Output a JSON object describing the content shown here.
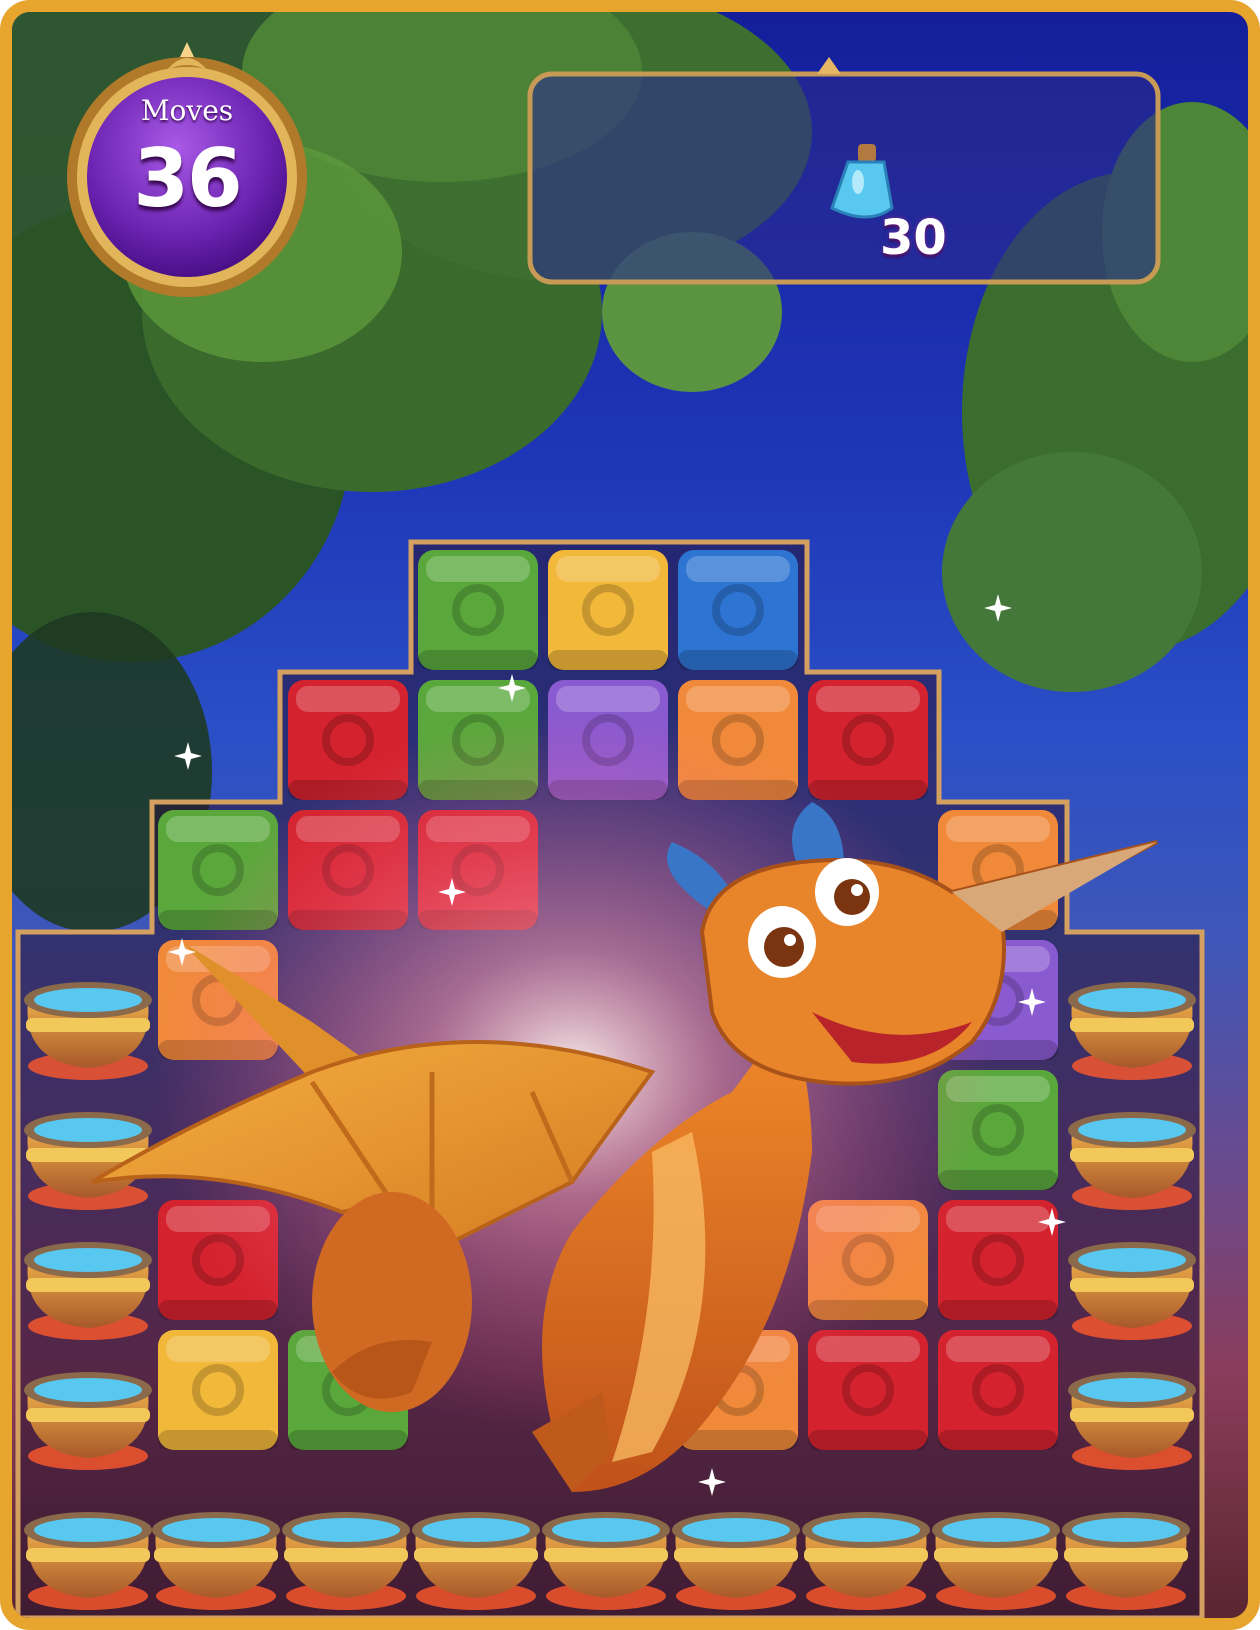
{
  "hud": {
    "moves_label": "Moves",
    "moves_value": "36",
    "goal": {
      "icon": "potion-bottle-icon",
      "count": "30"
    }
  },
  "colors": {
    "frame_gold": "#e7a52e",
    "moves_orb": "#7a2bbf",
    "block_green": "#5aa83c",
    "block_yellow": "#f1b83a",
    "block_blue": "#2e74d2",
    "block_red": "#d4232e",
    "block_purple": "#8a5ad0",
    "block_orange": "#f08a3a",
    "potion_blue": "#59c8f0"
  },
  "board": {
    "cauldron_icon": "cauldron-icon",
    "dragon": "dragon-character",
    "rows": [
      [
        "",
        "",
        "green",
        "yellow",
        "blue",
        "",
        ""
      ],
      [
        "",
        "red",
        "green",
        "purple",
        "orange",
        "red",
        ""
      ],
      [
        "green",
        "red",
        "red",
        "",
        "",
        "",
        "orange"
      ],
      [
        "orange",
        "",
        "",
        "",
        "",
        "",
        "purple"
      ],
      [
        "",
        "",
        "",
        "",
        "",
        "",
        "green"
      ],
      [
        "red",
        "",
        "",
        "",
        "",
        "orange",
        "red"
      ],
      [
        "yellow",
        "green",
        "",
        "",
        "orange",
        "red",
        "red"
      ]
    ]
  }
}
